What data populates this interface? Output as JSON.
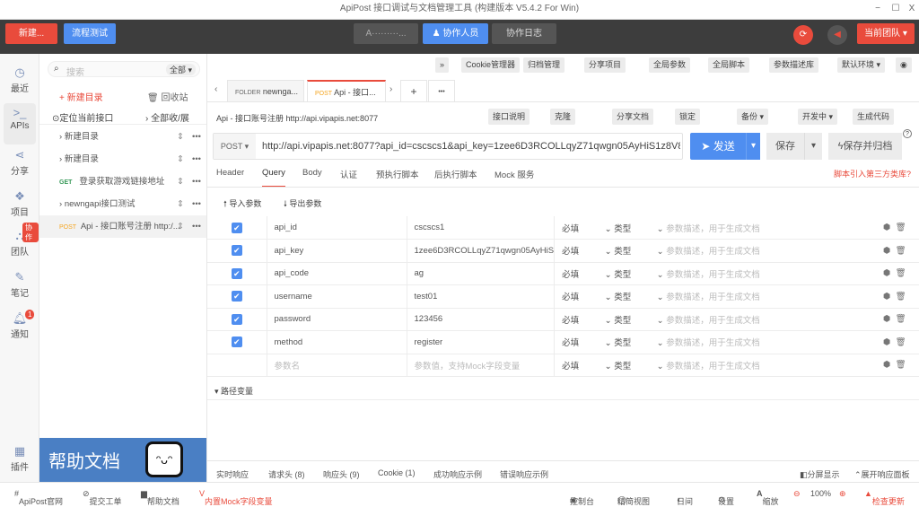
{
  "window": {
    "title": "ApiPost 接口调试与文档管理工具 (构建版本 V5.4.2 For Win)",
    "min": "−",
    "max": "☐",
    "close": "X"
  },
  "topbar": {
    "new": "新建...",
    "flow_test": "流程测试",
    "project": "A·········...",
    "collaborators": "协作人员",
    "collab_log": "协作日志",
    "team": "当前团队"
  },
  "nav": {
    "items": [
      {
        "label": "最近",
        "icon": "clock-icon"
      },
      {
        "label": "APIs",
        "icon": "terminal-icon"
      },
      {
        "label": "分享",
        "icon": "share-icon"
      },
      {
        "label": "项目",
        "icon": "cubes-icon"
      },
      {
        "label": "团队",
        "icon": "sitemap-icon",
        "badge": "协作"
      },
      {
        "label": "笔记",
        "icon": "edit-icon"
      },
      {
        "label": "通知",
        "icon": "bell-icon",
        "badge": "1"
      },
      {
        "label": "插件",
        "icon": "grid-icon"
      }
    ]
  },
  "sidebar": {
    "search_placeholder": "搜索",
    "filter": "全部",
    "new_folder": "+ 新建目录",
    "recycle": "回收站",
    "locate": "定位当前接口",
    "collapse": "全部收/展",
    "items": [
      {
        "type": "folder",
        "label": "新建目录"
      },
      {
        "type": "folder",
        "label": "新建目录"
      },
      {
        "type": "api",
        "method": "GET",
        "label": "登录获取游戏链接地址"
      },
      {
        "type": "folder",
        "label": "newngapi接口测试"
      },
      {
        "type": "api",
        "method": "POST",
        "label": "Api - 接口账号注册 http:/..."
      }
    ],
    "banner": "帮助文档"
  },
  "toolbar": [
    "»",
    "Cookie管理器",
    "归档管理",
    "分享项目",
    "全局参数",
    "全局脚本",
    "参数描述库",
    "默认环境 ▾",
    "◉"
  ],
  "tabs": [
    {
      "prefix": "FOLDER",
      "label": "newnga..."
    },
    {
      "prefix": "POST",
      "label": "Api - 接口..."
    }
  ],
  "tab_controls": {
    "prev": "‹",
    "next": "›",
    "add": "+",
    "more": "•••"
  },
  "request": {
    "title": "Api - 接口账号注册 http://api.vipapis.net:8077",
    "actions": [
      "接口说明",
      "克隆",
      "分享文档",
      "锁定",
      "备份 ▾",
      "开发中 ▾",
      "生成代码"
    ],
    "method": "POST",
    "url": "http://api.vipapis.net:8077?api_id=cscscs1&api_key=1zee6D3RCOLLqyZ71qwgn05AyHiS1z8V8",
    "send": "发送",
    "save": "保存",
    "save_archive": "保存并归档",
    "help": "?"
  },
  "req_tabs": [
    "Header",
    "Query",
    "Body",
    "认证",
    "预执行脚本",
    "后执行脚本",
    "Mock 服务"
  ],
  "third_party_link": "脚本引入第三方类库?",
  "params": {
    "import": "导入参数",
    "export": "导出参数",
    "required": "必填",
    "type": "类型",
    "desc_placeholder": "参数描述，用于生成文档",
    "name_placeholder": "参数名",
    "value_placeholder": "参数值，支持Mock字段变量",
    "rows": [
      {
        "name": "api_id",
        "value": "cscscs1"
      },
      {
        "name": "api_key",
        "value": "1zee6D3RCOLLqyZ71qwgn05AyHiS"
      },
      {
        "name": "api_code",
        "value": "ag"
      },
      {
        "name": "username",
        "value": "test01"
      },
      {
        "name": "password",
        "value": "123456"
      },
      {
        "name": "method",
        "value": "register"
      }
    ]
  },
  "path_vars": "路径变量",
  "response_tabs": [
    "实时响应",
    "请求头 (8)",
    "响应头 (9)",
    "Cookie (1)",
    "成功响应示例",
    "错误响应示例"
  ],
  "response_actions": [
    "分屏显示",
    "展开响应面板"
  ],
  "footer": {
    "left": [
      "ApiPost官网",
      "提交工单",
      "帮助文档",
      "内置Mock字段变量"
    ],
    "right": [
      "控制台",
      "精简视图",
      "日间",
      "设置",
      "缩放",
      "100%",
      "检查更新"
    ]
  },
  "colors": {
    "accent_red": "#e94b3c",
    "accent_blue": "#4f8ef0",
    "dark": "#3d3d3d"
  }
}
